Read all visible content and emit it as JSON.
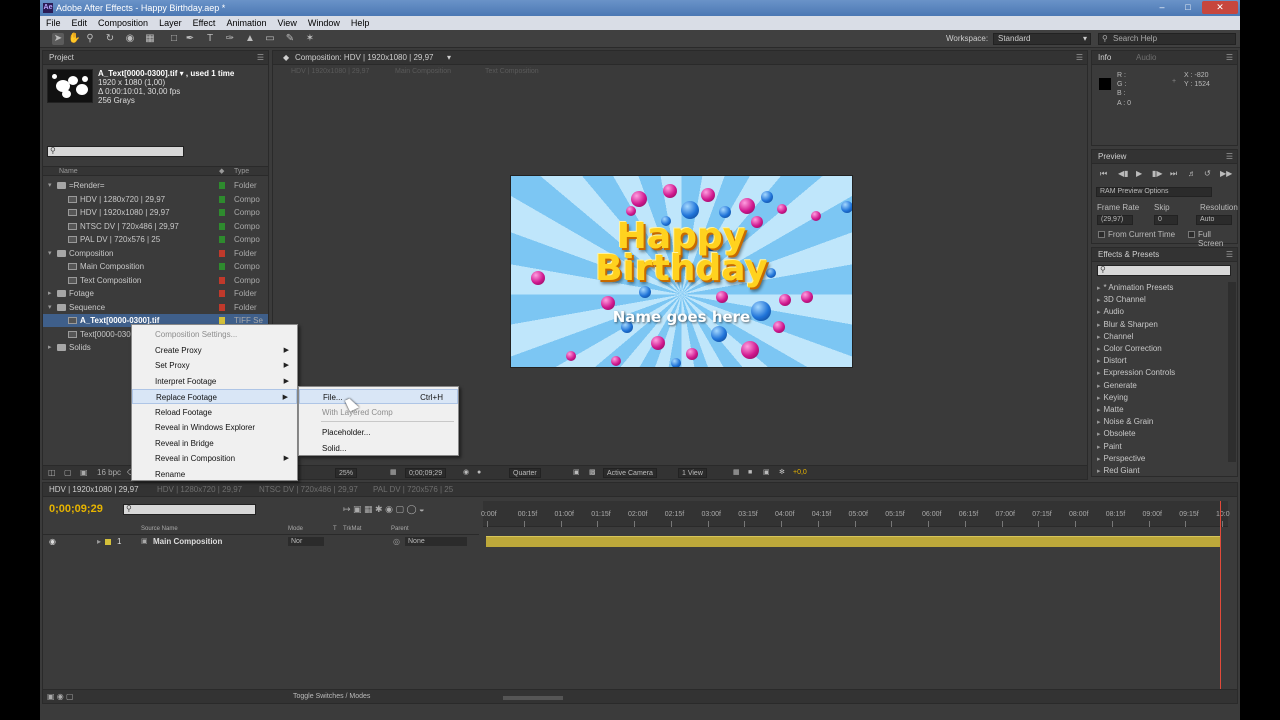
{
  "window": {
    "title": "Adobe After Effects - Happy Birthday.aep *",
    "logo": "Ae"
  },
  "menubar": [
    "File",
    "Edit",
    "Composition",
    "Layer",
    "Effect",
    "Animation",
    "View",
    "Window",
    "Help"
  ],
  "toolbar": {
    "workspace_label": "Workspace:",
    "workspace_value": "Standard",
    "search_placeholder": "Search Help"
  },
  "project": {
    "tab": "Project",
    "selected_file": {
      "name": "A_Text[0000-0300].tif ▾ , used 1 time",
      "dims": "1920 x 1080 (1,00)",
      "duration": "Δ 0:00:10:01, 30,00 fps",
      "color": "256 Grays"
    },
    "columns": {
      "name": "Name",
      "type": "Type"
    },
    "rows": [
      {
        "name": "=Render=",
        "type": "Folder",
        "kind": "folder",
        "indent": 0,
        "twirl": "▾",
        "label": "#2e8b2e"
      },
      {
        "name": "HDV | 1280x720 | 29,97",
        "type": "Compo",
        "kind": "comp",
        "indent": 1,
        "twirl": "",
        "label": "#2e8b2e"
      },
      {
        "name": "HDV | 1920x1080 | 29,97",
        "type": "Compo",
        "kind": "comp",
        "indent": 1,
        "twirl": "",
        "label": "#2e8b2e"
      },
      {
        "name": "NTSC DV | 720x486 | 29,97",
        "type": "Compo",
        "kind": "comp",
        "indent": 1,
        "twirl": "",
        "label": "#2e8b2e"
      },
      {
        "name": "PAL DV | 720x576 | 25",
        "type": "Compo",
        "kind": "comp",
        "indent": 1,
        "twirl": "",
        "label": "#2e8b2e"
      },
      {
        "name": "Composition",
        "type": "Folder",
        "kind": "folder",
        "indent": 0,
        "twirl": "▾",
        "label": "#c0392b"
      },
      {
        "name": "Main Composition",
        "type": "Compo",
        "kind": "comp",
        "indent": 1,
        "twirl": "",
        "label": "#2e8b2e"
      },
      {
        "name": "Text Composition",
        "type": "Compo",
        "kind": "comp",
        "indent": 1,
        "twirl": "",
        "label": "#c0392b"
      },
      {
        "name": "Fotage",
        "type": "Folder",
        "kind": "folder",
        "indent": 0,
        "twirl": "▸",
        "label": "#c0392b"
      },
      {
        "name": "Sequence",
        "type": "Folder",
        "kind": "folder",
        "indent": 0,
        "twirl": "▾",
        "label": "#c0392b"
      },
      {
        "name": "A_Text[0000-0300].tif",
        "type": "TIFF Se",
        "kind": "footage",
        "indent": 1,
        "twirl": "",
        "label": "#d4c03a",
        "selected": true
      },
      {
        "name": "Text[0000-0300]",
        "type": "",
        "kind": "footage",
        "indent": 1,
        "twirl": "",
        "label": ""
      },
      {
        "name": "Solids",
        "type": "",
        "kind": "folder",
        "indent": 0,
        "twirl": "▸",
        "label": ""
      }
    ],
    "bpc": "16 bpc"
  },
  "composition": {
    "tab": "Composition: HDV | 1920x1080 | 29,97",
    "breadcrumbs": [
      "HDV | 1920x1080 | 29,97",
      "Main Composition",
      "Text Composition"
    ],
    "title_line1": "Happy",
    "title_line2": "Birthday",
    "name_text": "Name goes here",
    "bottom": {
      "zoom": "25%",
      "time": "0;00;09;29",
      "quality": "Quarter",
      "camera": "Active Camera",
      "view": "1 View",
      "offset": "+0,0"
    }
  },
  "info": {
    "tabs": [
      "Info",
      "Audio"
    ],
    "r": "R :",
    "g": "G :",
    "b": "B :",
    "a": "A : 0",
    "x": "X : -820",
    "y": "Y : 1524"
  },
  "preview": {
    "tab": "Preview",
    "options": "RAM Preview Options",
    "frame_rate_label": "Frame Rate",
    "skip_label": "Skip",
    "resolution_label": "Resolution",
    "frame_rate": "(29,97)",
    "skip": "0",
    "resolution": "Auto",
    "from_current": "From Current Time",
    "full_screen": "Full Screen"
  },
  "effects": {
    "tab": "Effects & Presets",
    "items": [
      "* Animation Presets",
      "3D Channel",
      "Audio",
      "Blur & Sharpen",
      "Channel",
      "Color Correction",
      "Distort",
      "Expression Controls",
      "Generate",
      "Keying",
      "Matte",
      "Noise & Grain",
      "Obsolete",
      "Paint",
      "Perspective",
      "Red Giant"
    ]
  },
  "timeline": {
    "tabs": [
      "HDV | 1920x1080 | 29,97",
      "HDV | 1280x720 | 29,97",
      "NTSC DV | 720x486 | 29,97",
      "PAL DV | 720x576 | 25"
    ],
    "time": "0;00;09;29",
    "columns": {
      "source": "Source Name",
      "mode": "Mode",
      "t": "T",
      "trkmat": "TrkMat",
      "parent": "Parent"
    },
    "layer": {
      "num": "1",
      "name": "Main Composition",
      "mode": "Nor",
      "parent": "None"
    },
    "ticks": [
      "0:00f",
      "00:15f",
      "01:00f",
      "01:15f",
      "02:00f",
      "02:15f",
      "03:00f",
      "03:15f",
      "04:00f",
      "04:15f",
      "05:00f",
      "05:15f",
      "06:00f",
      "06:15f",
      "07:00f",
      "07:15f",
      "08:00f",
      "08:15f",
      "09:00f",
      "09:15f",
      "10:0"
    ],
    "toggle": "Toggle Switches / Modes"
  },
  "context_menu": {
    "items": [
      {
        "label": "Composition Settings...",
        "disabled": true,
        "submenu": false
      },
      {
        "label": "Create Proxy",
        "disabled": false,
        "submenu": true
      },
      {
        "label": "Set Proxy",
        "disabled": false,
        "submenu": true
      },
      {
        "label": "Interpret Footage",
        "disabled": false,
        "submenu": true
      },
      {
        "label": "Replace Footage",
        "disabled": false,
        "submenu": true,
        "highlight": true
      },
      {
        "label": "Reload Footage",
        "disabled": false,
        "submenu": false
      },
      {
        "label": "Reveal in Windows Explorer",
        "disabled": false,
        "submenu": false
      },
      {
        "label": "Reveal in Bridge",
        "disabled": false,
        "submenu": false
      },
      {
        "label": "Reveal in Composition",
        "disabled": false,
        "submenu": true
      },
      {
        "label": "Rename",
        "disabled": false,
        "submenu": false
      }
    ]
  },
  "submenu": {
    "items": [
      {
        "label": "File...",
        "shortcut": "Ctrl+H",
        "disabled": false,
        "highlight": true
      },
      {
        "label": "With Layered Comp",
        "shortcut": "",
        "disabled": true
      },
      {
        "label": "Placeholder...",
        "shortcut": "",
        "disabled": false
      },
      {
        "label": "Solid...",
        "shortcut": "",
        "disabled": false
      }
    ]
  }
}
